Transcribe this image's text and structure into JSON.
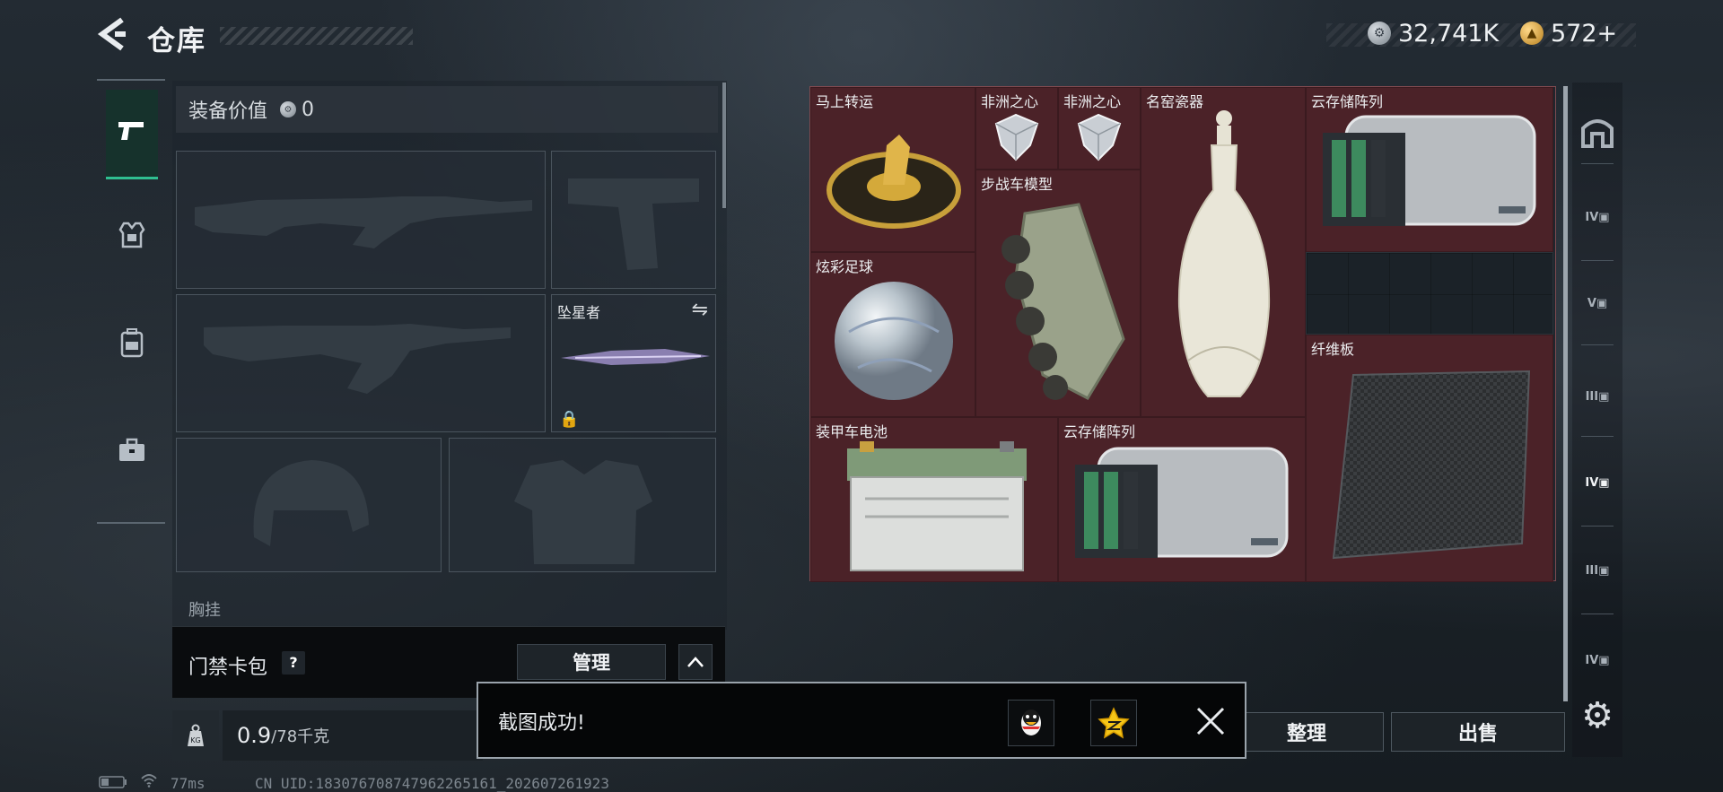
{
  "header": {
    "title": "仓库"
  },
  "currency": {
    "silver": "32,741K",
    "gold": "572+"
  },
  "equipment": {
    "value_label": "装备价值",
    "value": "0",
    "melee_slot_label": "坠星者",
    "chest_label": "胸挂"
  },
  "card_bar": {
    "label": "门禁卡包",
    "help": "?",
    "manage_button": "管理"
  },
  "weight": {
    "current": "0.9",
    "max": "/78千克",
    "unit_icon": "KG"
  },
  "inventory": {
    "items": [
      {
        "id": "horse-coin",
        "label": "马上转运"
      },
      {
        "id": "african-heart-1",
        "label": "非洲之心"
      },
      {
        "id": "african-heart-2",
        "label": "非洲之心"
      },
      {
        "id": "porcelain",
        "label": "名窑瓷器"
      },
      {
        "id": "cloud-storage-1",
        "label": "云存储阵列"
      },
      {
        "id": "ifv-model",
        "label": "步战车模型"
      },
      {
        "id": "football",
        "label": "炫彩足球"
      },
      {
        "id": "fiberboard",
        "label": "纤维板"
      },
      {
        "id": "apc-battery",
        "label": "装甲车电池"
      },
      {
        "id": "cloud-storage-2",
        "label": "云存储阵列"
      }
    ]
  },
  "right_rail": {
    "tier_labels": [
      "IV",
      "V",
      "III",
      "IV",
      "III",
      "IV"
    ]
  },
  "bottom_buttons": {
    "sort": "整理",
    "sell": "出售"
  },
  "toast": {
    "message": "截图成功!"
  },
  "status_bar": {
    "ping": "77ms",
    "uid": "CN UID:183076708747962265161_202607261923"
  },
  "colors": {
    "accent_green": "#2fbf90",
    "item_bg": "#4b2228"
  }
}
